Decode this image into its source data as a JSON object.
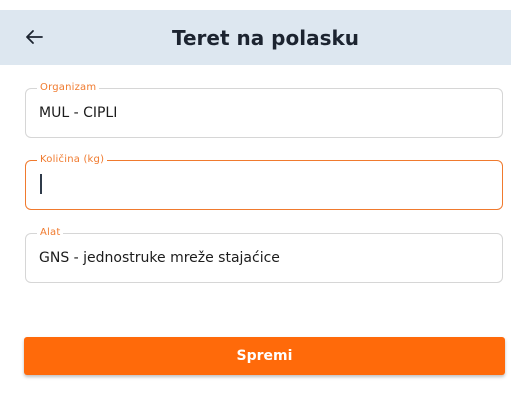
{
  "header": {
    "title": "Teret na polasku",
    "back_icon": "arrow-left-icon"
  },
  "form": {
    "organism": {
      "label": "Organizam",
      "value": "MUL - CIPLI"
    },
    "quantity": {
      "label": "Količina (kg)",
      "value": ""
    },
    "tool": {
      "label": "Alat",
      "value": "GNS - jednostruke mreže stajaćice"
    }
  },
  "actions": {
    "save_label": "Spremi"
  },
  "colors": {
    "accent": "#ff6a0a",
    "app_bar": "#dde7f0",
    "label": "#f07a2e"
  }
}
